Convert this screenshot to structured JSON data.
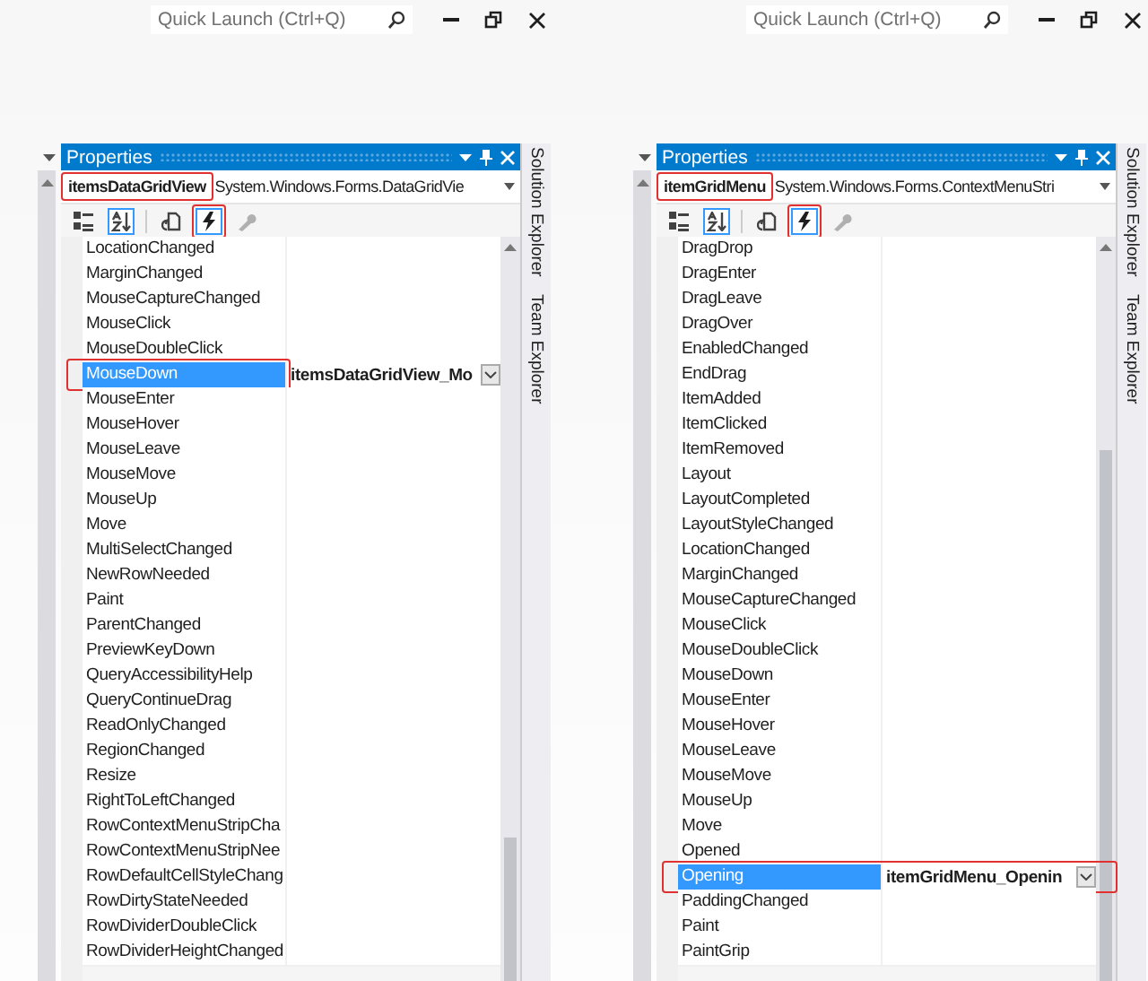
{
  "panes": [
    {
      "quick_launch": {
        "placeholder": "Quick Launch (Ctrl+Q)"
      },
      "properties": {
        "title": "Properties",
        "object_name": "itemsDataGridView",
        "object_type": "System.Windows.Forms.DataGridVie",
        "object_highlighted": true,
        "toolbar": [
          {
            "kind": "categorized",
            "selected": false,
            "highlighted": false
          },
          {
            "kind": "alphabetical",
            "selected": true,
            "highlighted": false
          },
          {
            "kind": "properties",
            "selected": false,
            "highlighted": false
          },
          {
            "kind": "events",
            "selected": true,
            "highlighted": true
          },
          {
            "kind": "property_pages",
            "selected": false,
            "highlighted": false
          }
        ],
        "events": [
          {
            "name": "LocationChanged",
            "selected": false
          },
          {
            "name": "MarginChanged",
            "selected": false
          },
          {
            "name": "MouseCaptureChanged",
            "selected": false
          },
          {
            "name": "MouseClick",
            "selected": false
          },
          {
            "name": "MouseDoubleClick",
            "selected": false
          },
          {
            "name": "MouseDown",
            "value": "itemsDataGridView_Mo",
            "selected": true,
            "highlighted": true
          },
          {
            "name": "MouseEnter",
            "selected": false
          },
          {
            "name": "MouseHover",
            "selected": false
          },
          {
            "name": "MouseLeave",
            "selected": false
          },
          {
            "name": "MouseMove",
            "selected": false
          },
          {
            "name": "MouseUp",
            "selected": false
          },
          {
            "name": "Move",
            "selected": false
          },
          {
            "name": "MultiSelectChanged",
            "selected": false
          },
          {
            "name": "NewRowNeeded",
            "selected": false
          },
          {
            "name": "Paint",
            "selected": false
          },
          {
            "name": "ParentChanged",
            "selected": false
          },
          {
            "name": "PreviewKeyDown",
            "selected": false
          },
          {
            "name": "QueryAccessibilityHelp",
            "selected": false
          },
          {
            "name": "QueryContinueDrag",
            "selected": false
          },
          {
            "name": "ReadOnlyChanged",
            "selected": false
          },
          {
            "name": "RegionChanged",
            "selected": false
          },
          {
            "name": "Resize",
            "selected": false
          },
          {
            "name": "RightToLeftChanged",
            "selected": false
          },
          {
            "name": "RowContextMenuStripCha",
            "selected": false
          },
          {
            "name": "RowContextMenuStripNee",
            "selected": false
          },
          {
            "name": "RowDefaultCellStyleChang",
            "selected": false
          },
          {
            "name": "RowDirtyStateNeeded",
            "selected": false
          },
          {
            "name": "RowDividerDoubleClick",
            "selected": false
          },
          {
            "name": "RowDividerHeightChanged",
            "selected": false
          }
        ]
      },
      "side_tabs": [
        "Solution Explorer",
        "Team Explorer"
      ]
    },
    {
      "quick_launch": {
        "placeholder": "Quick Launch (Ctrl+Q)"
      },
      "properties": {
        "title": "Properties",
        "object_name": "itemGridMenu",
        "object_type": "System.Windows.Forms.ContextMenuStri",
        "object_highlighted": true,
        "toolbar": [
          {
            "kind": "categorized",
            "selected": false,
            "highlighted": false
          },
          {
            "kind": "alphabetical",
            "selected": true,
            "highlighted": false
          },
          {
            "kind": "properties",
            "selected": false,
            "highlighted": false
          },
          {
            "kind": "events",
            "selected": true,
            "highlighted": true
          },
          {
            "kind": "property_pages",
            "selected": false,
            "highlighted": false
          }
        ],
        "events": [
          {
            "name": "DragDrop",
            "selected": false
          },
          {
            "name": "DragEnter",
            "selected": false
          },
          {
            "name": "DragLeave",
            "selected": false
          },
          {
            "name": "DragOver",
            "selected": false
          },
          {
            "name": "EnabledChanged",
            "selected": false
          },
          {
            "name": "EndDrag",
            "selected": false
          },
          {
            "name": "ItemAdded",
            "selected": false
          },
          {
            "name": "ItemClicked",
            "selected": false
          },
          {
            "name": "ItemRemoved",
            "selected": false
          },
          {
            "name": "Layout",
            "selected": false
          },
          {
            "name": "LayoutCompleted",
            "selected": false
          },
          {
            "name": "LayoutStyleChanged",
            "selected": false
          },
          {
            "name": "LocationChanged",
            "selected": false
          },
          {
            "name": "MarginChanged",
            "selected": false
          },
          {
            "name": "MouseCaptureChanged",
            "selected": false
          },
          {
            "name": "MouseClick",
            "selected": false
          },
          {
            "name": "MouseDoubleClick",
            "selected": false
          },
          {
            "name": "MouseDown",
            "selected": false
          },
          {
            "name": "MouseEnter",
            "selected": false
          },
          {
            "name": "MouseHover",
            "selected": false
          },
          {
            "name": "MouseLeave",
            "selected": false
          },
          {
            "name": "MouseMove",
            "selected": false
          },
          {
            "name": "MouseUp",
            "selected": false
          },
          {
            "name": "Move",
            "selected": false
          },
          {
            "name": "Opened",
            "selected": false
          },
          {
            "name": "Opening",
            "value": "itemGridMenu_Openin",
            "selected": true,
            "highlighted": true
          },
          {
            "name": "PaddingChanged",
            "selected": false
          },
          {
            "name": "Paint",
            "selected": false
          },
          {
            "name": "PaintGrip",
            "selected": false
          }
        ]
      },
      "side_tabs": [
        "Solution Explorer",
        "Team Explorer"
      ]
    }
  ]
}
